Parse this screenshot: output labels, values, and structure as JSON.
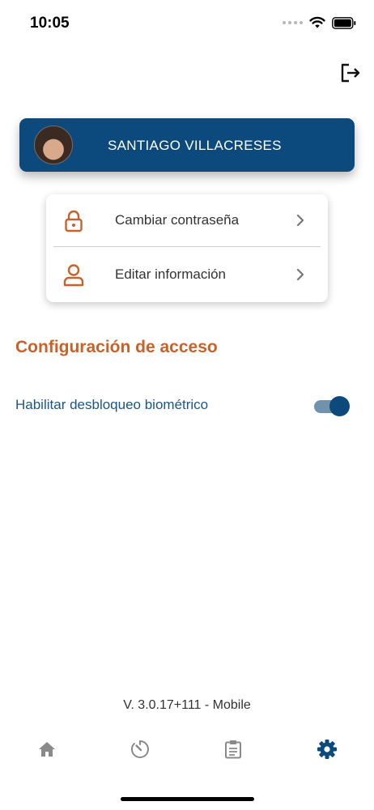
{
  "status_bar": {
    "time": "10:05",
    "icons": [
      "signal-dots-icon",
      "wifi-icon",
      "battery-icon"
    ]
  },
  "header": {
    "logout_icon": "logout-icon"
  },
  "profile": {
    "name": "SANTIAGO VILLACRESES",
    "card_color": "#0c4a7e"
  },
  "menu": {
    "items": [
      {
        "label": "Cambiar contraseña",
        "icon": "lock-icon"
      },
      {
        "label": "Editar información",
        "icon": "user-icon"
      }
    ],
    "icon_color": "#c8622a"
  },
  "access": {
    "title": "Configuración de acceso",
    "biometric_label": "Habilitar desbloqueo biométrico",
    "biometric_enabled": true
  },
  "footer": {
    "version": "V. 3.0.17+111 - Mobile"
  },
  "bottom_nav": {
    "items": [
      {
        "icon": "home-icon",
        "active": false
      },
      {
        "icon": "timer-icon",
        "active": false
      },
      {
        "icon": "clipboard-icon",
        "active": false
      },
      {
        "icon": "settings-gear-icon",
        "active": true
      }
    ],
    "active_color": "#0c4a7e",
    "inactive_color": "#8a8a8a"
  }
}
